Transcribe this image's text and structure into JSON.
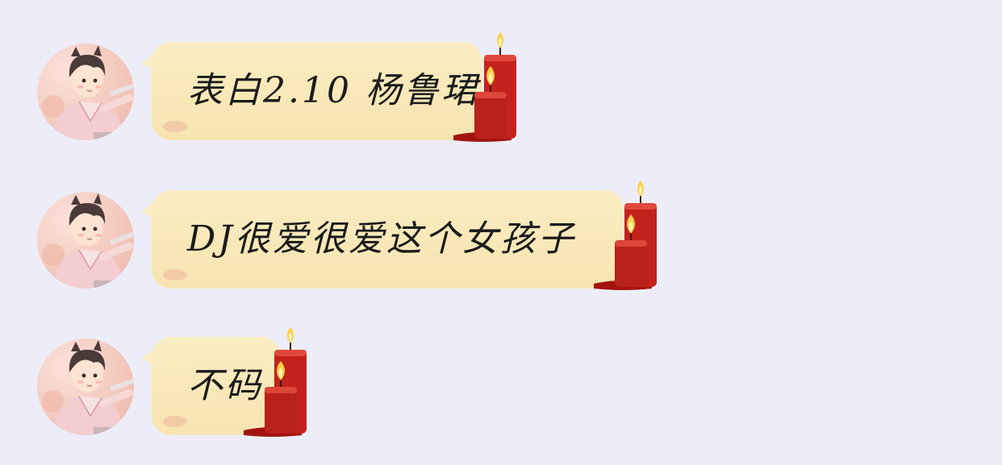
{
  "chat": {
    "messages": [
      {
        "text": "表白2.10 杨鲁珺"
      },
      {
        "text": "DJ很爱很爱这个女孩子"
      },
      {
        "text": "不码"
      }
    ]
  },
  "colors": {
    "background": "#ecedf8",
    "bubble": "#f8e8b8",
    "candle_red": "#c3211b",
    "flame": "#ffcf4a"
  },
  "icons": {
    "avatar": "boy-avatar",
    "decoration": "candle-icon"
  }
}
